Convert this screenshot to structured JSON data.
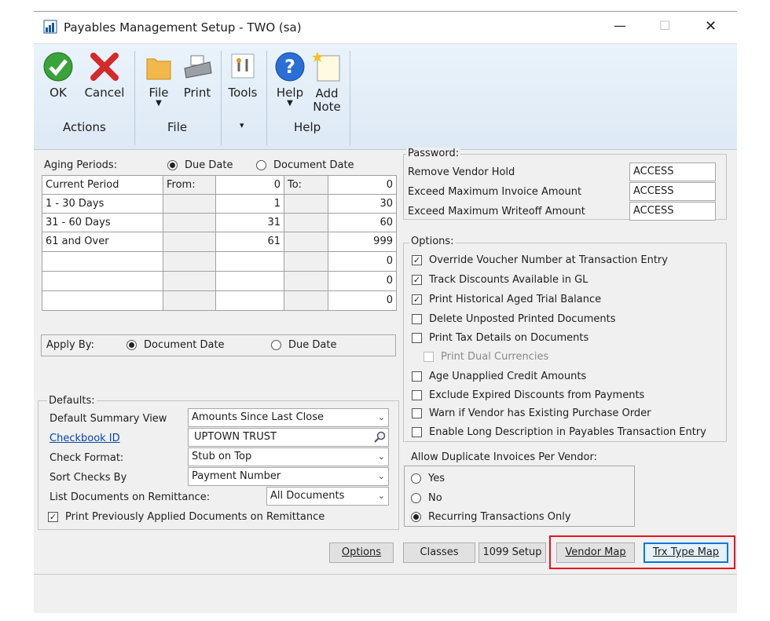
{
  "window": {
    "title": "Payables Management Setup  -  TWO (sa)",
    "minimize": "—",
    "maximize": "☐",
    "close": "✕"
  },
  "ribbon": {
    "buttons": [
      {
        "label": "OK",
        "icon": "ok-check-icon"
      },
      {
        "label": "Cancel",
        "icon": "cancel-x-icon"
      },
      {
        "label": "File",
        "icon": "folder-icon"
      },
      {
        "label": "Print",
        "icon": "printer-icon"
      },
      {
        "label": "Tools",
        "icon": "tools-icon"
      },
      {
        "label": "Help",
        "icon": "help-icon"
      },
      {
        "label": "Add",
        "label2": "Note",
        "icon": "add-note-icon"
      }
    ],
    "groups": [
      "Actions",
      "File",
      "Help"
    ],
    "tools_group_arrow": "▾",
    "dropdown_arrow": "▼"
  },
  "aging": {
    "label": "Aging Periods:",
    "option_due": "Due Date",
    "option_doc": "Document Date",
    "selected": "Due Date",
    "header": {
      "period": "Current Period",
      "from": "From:",
      "from_val": "0",
      "to": "To:",
      "to_val": "0"
    },
    "rows": [
      {
        "period": "1 - 30 Days",
        "from": "1",
        "to": "30"
      },
      {
        "period": "31 - 60 Days",
        "from": "31",
        "to": "60"
      },
      {
        "period": "61 and Over",
        "from": "61",
        "to": "999"
      },
      {
        "period": "",
        "from": "",
        "to": "0"
      },
      {
        "period": "",
        "from": "",
        "to": "0"
      },
      {
        "period": "",
        "from": "",
        "to": "0"
      }
    ]
  },
  "apply_by": {
    "label": "Apply By:",
    "option_doc": "Document Date",
    "option_due": "Due Date",
    "selected": "Document Date"
  },
  "password": {
    "label": "Password:",
    "rows": [
      {
        "label": "Remove Vendor Hold",
        "value": "ACCESS"
      },
      {
        "label": "Exceed Maximum Invoice Amount",
        "value": "ACCESS"
      },
      {
        "label": "Exceed Maximum Writeoff Amount",
        "value": "ACCESS"
      }
    ]
  },
  "options": {
    "label": "Options:",
    "items": [
      {
        "label": "Override Voucher Number at Transaction Entry",
        "checked": true
      },
      {
        "label": "Track Discounts  Available in GL",
        "checked": true
      },
      {
        "label": "Print Historical  Aged Trial Balance",
        "checked": true
      },
      {
        "label": "Delete Unposted Printed Documents",
        "checked": false
      },
      {
        "label": "Print Tax Details on Documents",
        "checked": false
      },
      {
        "label": "Print Dual Currencies",
        "checked": false,
        "disabled": true
      },
      {
        "label": "Age Unapplied Credit Amounts",
        "checked": false
      },
      {
        "label": "Exclude Expired Discounts from Payments",
        "checked": false
      },
      {
        "label": "Warn if Vendor has Existing Purchase Order",
        "checked": false
      },
      {
        "label": "Enable Long Description in Payables Transaction Entry",
        "checked": false
      }
    ]
  },
  "dup_invoices": {
    "label": "Allow Duplicate Invoices Per Vendor:",
    "options": [
      "Yes",
      "No",
      "Recurring Transactions Only"
    ],
    "selected": "Recurring Transactions Only"
  },
  "defaults": {
    "label": "Defaults:",
    "summary_view_label": "Default Summary View",
    "summary_view_value": "Amounts Since Last Close",
    "checkbook_label": "Checkbook ID",
    "checkbook_value": "UPTOWN TRUST",
    "check_format_label": "Check Format:",
    "check_format_value": "Stub on Top",
    "sort_checks_label": "Sort Checks By",
    "sort_checks_value": "Payment Number",
    "list_docs_label": "List Documents on Remittance:",
    "list_docs_value": "All Documents",
    "print_prev_label": "Print Previously Applied Documents on Remittance",
    "print_prev_checked": true
  },
  "buttons": {
    "options": "Options",
    "classes": "Classes",
    "setup_1099": "1099 Setup",
    "vendor_map": "Vendor Map",
    "trx_type_map": "Trx Type Map"
  },
  "colors": {
    "highlight_border": "#e8141c",
    "link": "#0645ad",
    "accent": "#0078d7"
  }
}
